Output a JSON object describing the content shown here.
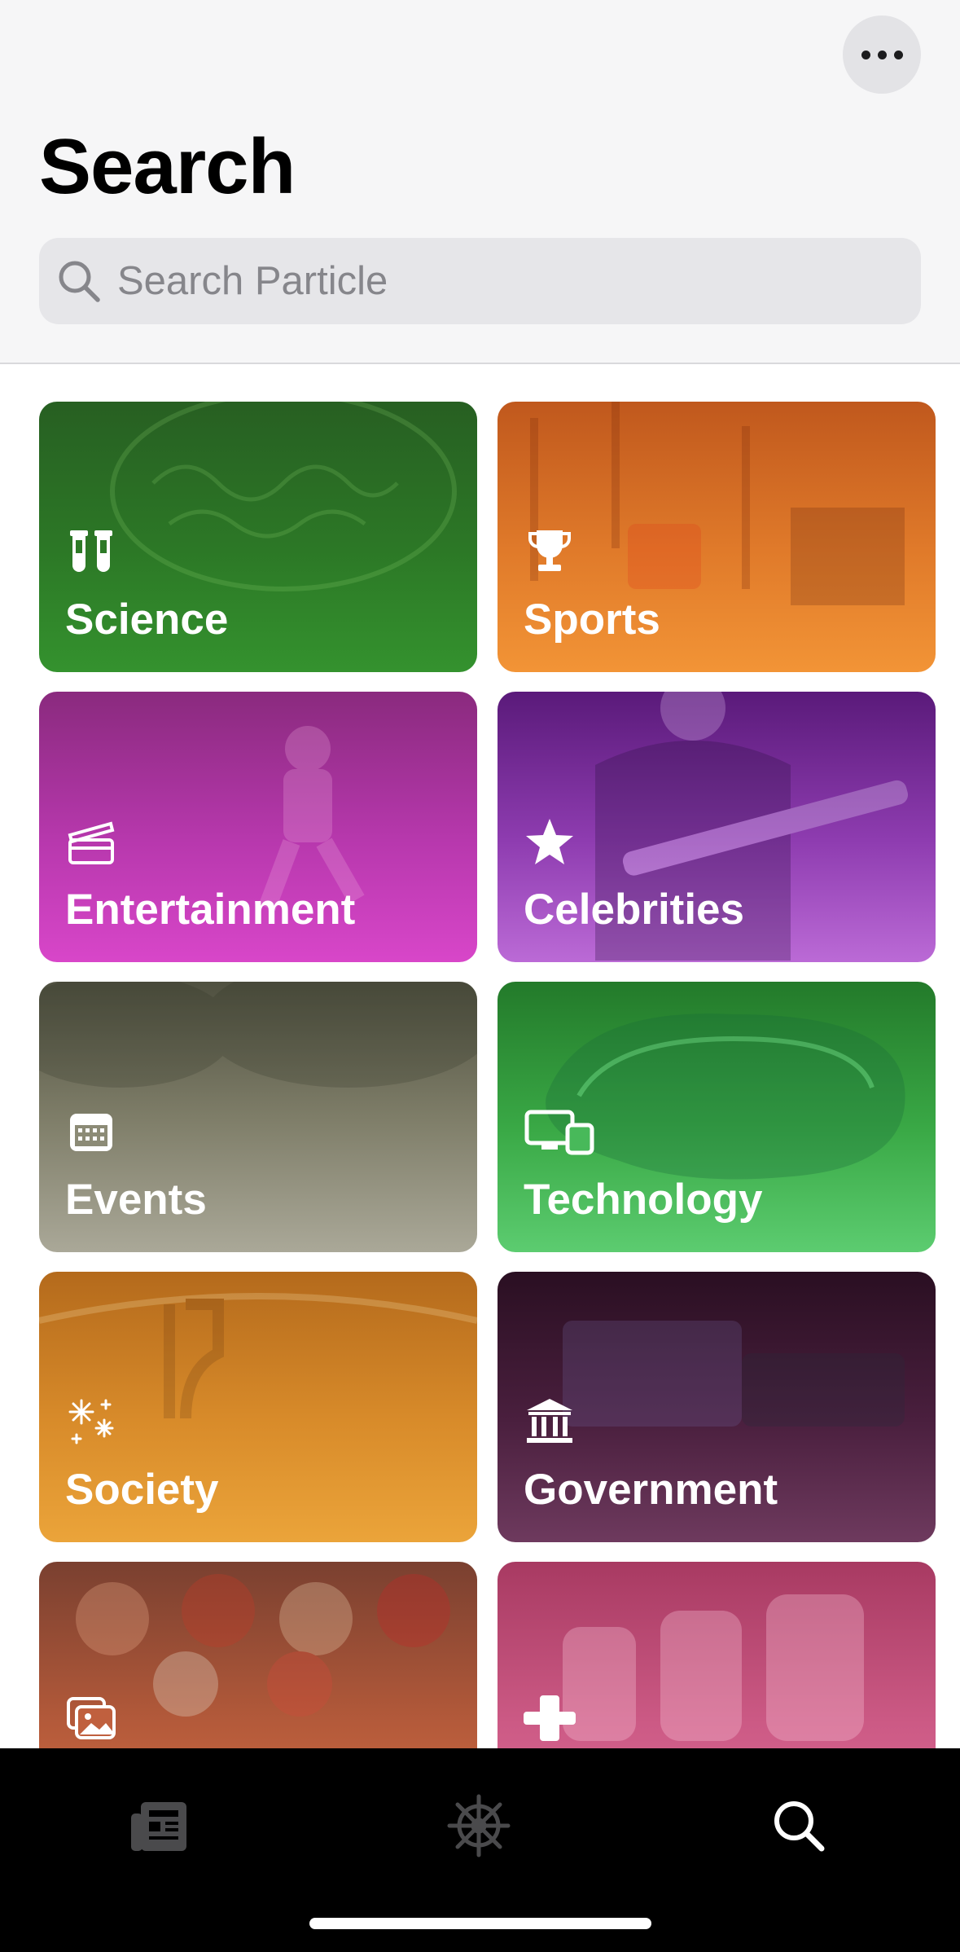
{
  "header": {
    "title": "Search",
    "more_icon": "ellipsis-icon",
    "search": {
      "placeholder": "Search Particle",
      "icon": "magnifying-glass-icon"
    }
  },
  "categories": [
    {
      "label": "Science",
      "icon": "test-tubes-icon",
      "color": "#2f8a2a"
    },
    {
      "label": "Sports",
      "icon": "trophy-icon",
      "color": "#f28a2c"
    },
    {
      "label": "Entertainment",
      "icon": "clapperboard-icon",
      "color": "#c93bbd"
    },
    {
      "label": "Celebrities",
      "icon": "star-icon",
      "color": "#a35ad0"
    },
    {
      "label": "Events",
      "icon": "calendar-icon",
      "color": "#8f8d78"
    },
    {
      "label": "Technology",
      "icon": "devices-icon",
      "color": "#3fb84f"
    },
    {
      "label": "Society",
      "icon": "sparkles-icon",
      "color": "#e59a2b"
    },
    {
      "label": "Government",
      "icon": "bank-building-icon",
      "color": "#5a2a4a"
    },
    {
      "label": "",
      "icon": "photos-icon",
      "color": "#c45a3e"
    },
    {
      "label": "",
      "icon": "plus-cross-icon",
      "color": "#d05a86"
    }
  ],
  "tabbar": {
    "tabs": [
      {
        "name": "news",
        "icon": "newspaper-icon",
        "active": false
      },
      {
        "name": "explore",
        "icon": "helm-wheel-icon",
        "active": false
      },
      {
        "name": "search",
        "icon": "search-icon",
        "active": true
      }
    ],
    "active_color": "#ffffff",
    "inactive_color": "#4a4a4c"
  }
}
